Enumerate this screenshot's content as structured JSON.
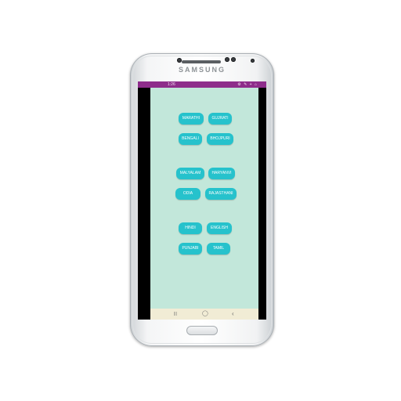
{
  "device": {
    "brand": "SAMSUNG"
  },
  "status_bar": {
    "time": "1:26",
    "icons": "⚙ ✎ + ⌂",
    "color": "#8e2d8b"
  },
  "app": {
    "background": "#c2e7da",
    "button_color": "#26c2cc",
    "languages": [
      "MARATHI",
      "GUJRATI",
      "BENGALI",
      "BHOJPURI",
      "MALYALAM",
      "HARYANVI",
      "ODIA",
      "RAJASTHANI",
      "HINDI",
      "ENGLISH",
      "PUNJABI",
      "TAMIL"
    ]
  },
  "nav_bar": {
    "recents": "|||",
    "home": "◯",
    "back": "‹"
  }
}
